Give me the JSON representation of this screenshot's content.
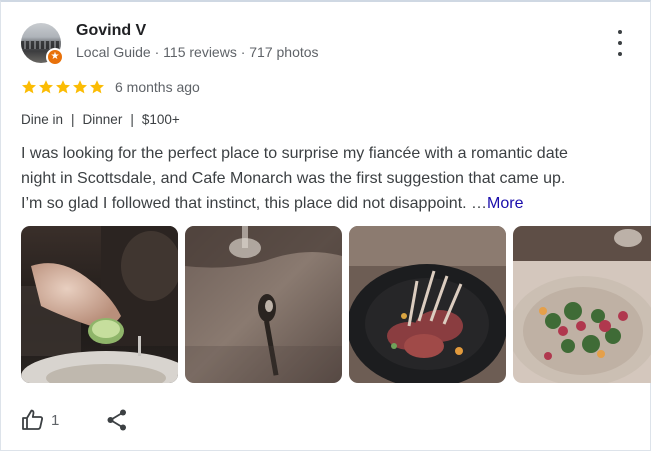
{
  "reviewer": {
    "name": "Govind V",
    "meta": "Local Guide · 115 reviews · 717 photos",
    "avatar_icon": "profile-photo-icon",
    "badge_icon": "local-guide-star-icon",
    "badge_color": "#e8710a"
  },
  "menu": {
    "icon": "more-vertical-icon"
  },
  "rating": {
    "stars": 5,
    "max": 5,
    "star_color": "#fbbc04",
    "date": "6 months ago"
  },
  "tags": [
    "Dine in",
    "Dinner",
    "$100+"
  ],
  "tag_separator": "|",
  "review": {
    "lines": [
      "I was looking for the perfect place to surprise my fiancée with a romantic date",
      "night in Scottsdale, and Cafe Monarch was the first suggestion that came up.",
      "I’m so glad I followed that instinct, this place did not disappoint. …"
    ],
    "more_label": "More",
    "more_color": "#1a0dab"
  },
  "photos": [
    {
      "icon": "photo-pouring-sauce"
    },
    {
      "icon": "photo-table-spoon"
    },
    {
      "icon": "photo-lamb-rack"
    },
    {
      "icon": "photo-salad-plate"
    }
  ],
  "actions": {
    "like_icon": "thumbs-up-icon",
    "like_count": "1",
    "share_icon": "share-icon"
  }
}
